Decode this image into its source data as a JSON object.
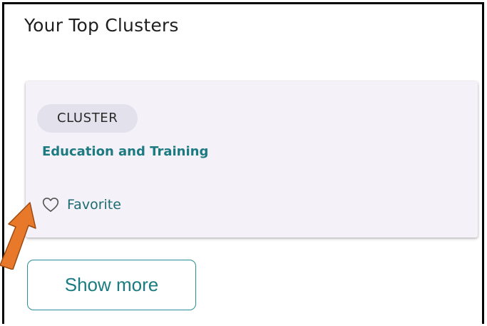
{
  "section": {
    "title": "Your Top Clusters"
  },
  "card": {
    "tag_label": "CLUSTER",
    "title": "Education and Training",
    "favorite_label": "Favorite"
  },
  "actions": {
    "show_more_label": "Show more"
  },
  "icons": {
    "favorite": "heart-outline-icon",
    "annotation": "arrow-annotation"
  },
  "colors": {
    "accent": "#1d7a81",
    "card_background": "#f4f2f8",
    "tag_background": "#e3e1ec",
    "annotation_arrow": "#e8792b"
  }
}
